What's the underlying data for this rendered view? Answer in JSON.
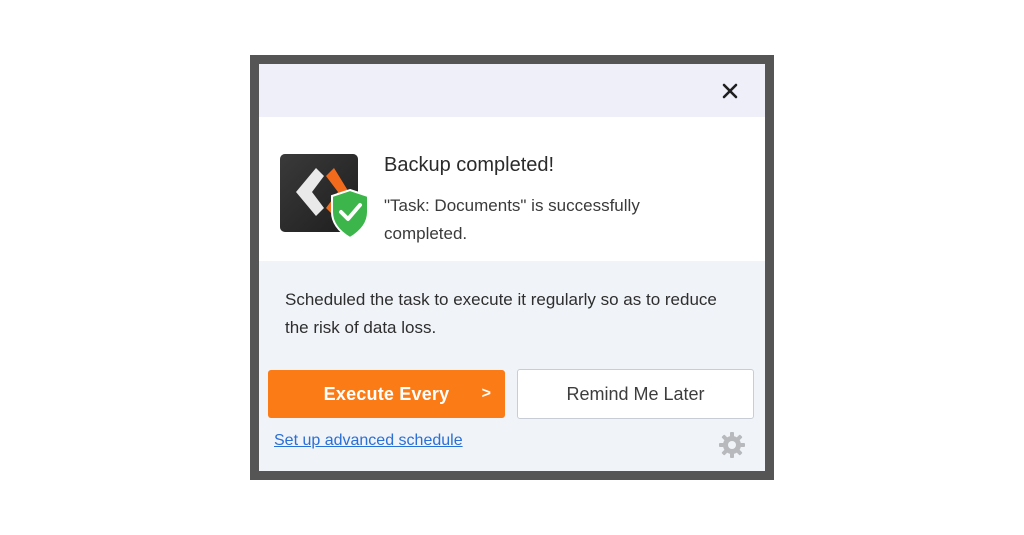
{
  "dialog": {
    "close_icon": "close-icon",
    "app_icon": "backup-app-icon-with-green-shield-check",
    "title": "Backup completed!",
    "message": "\"Task: Documents\" is successfully completed.",
    "info": "Scheduled the task to execute it regularly so as to reduce the risk of data loss.",
    "primary_button": {
      "label": "Execute Every",
      "chevron": ">",
      "color": "#fb7c17"
    },
    "secondary_button": {
      "label": "Remind Me Later"
    },
    "advanced_link": "Set up advanced schedule",
    "settings_icon": "gear-icon",
    "colors": {
      "link": "#2a6fd6",
      "shield": "#3cb54a",
      "frame": "#555555"
    }
  }
}
